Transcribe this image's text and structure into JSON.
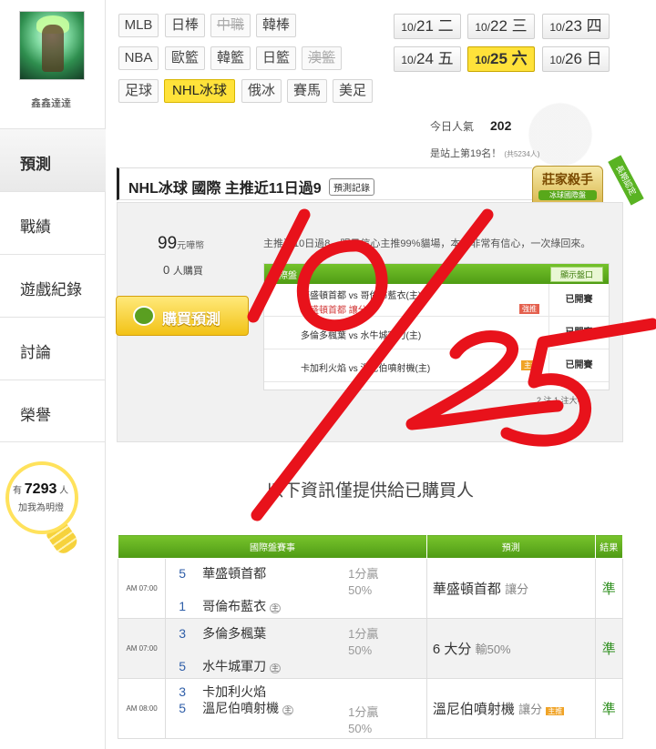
{
  "sidebar": {
    "username": "鑫鑫達達",
    "nav": [
      "預測",
      "戰績",
      "遊戲紀錄",
      "討論",
      "榮譽"
    ],
    "bulb": {
      "prefix": "有",
      "count": "7293",
      "suffix": "人",
      "line2": "加我為明燈"
    }
  },
  "leagues": [
    {
      "label": "MLB",
      "state": "normal"
    },
    {
      "label": "日棒",
      "state": "normal"
    },
    {
      "label": "中職",
      "state": "disabled"
    },
    {
      "label": "韓棒",
      "state": "normal"
    },
    {
      "label": "NBA",
      "state": "normal"
    },
    {
      "label": "歐籃",
      "state": "normal"
    },
    {
      "label": "韓籃",
      "state": "normal"
    },
    {
      "label": "日籃",
      "state": "normal"
    },
    {
      "label": "澳籃",
      "state": "disabled"
    },
    {
      "label": "足球",
      "state": "normal"
    },
    {
      "label": "NHL冰球",
      "state": "selected"
    },
    {
      "label": "俄冰",
      "state": "normal"
    },
    {
      "label": "賽馬",
      "state": "normal"
    },
    {
      "label": "美足",
      "state": "normal"
    }
  ],
  "dates": [
    {
      "md": "10/",
      "d": "21",
      "w": "二"
    },
    {
      "md": "10/",
      "d": "22",
      "w": "三"
    },
    {
      "md": "10/",
      "d": "23",
      "w": "四"
    },
    {
      "md": "10/",
      "d": "24",
      "w": "五"
    },
    {
      "md": "10/",
      "d": "25",
      "w": "六"
    },
    {
      "md": "10/",
      "d": "26",
      "w": "日"
    }
  ],
  "stats": {
    "popularity_label": "今日人氣",
    "popularity_value": "202",
    "rank_text": "是站上第19名！",
    "rank_note": "(共5234人)"
  },
  "badge": {
    "title": "莊家殺手",
    "sub": "冰球國際盤",
    "ribbon": "長期認定"
  },
  "section": {
    "title": "NHL冰球 國際 主推近11日過9",
    "record_button": "預測記錄"
  },
  "purchase": {
    "price": "99",
    "price_unit": "元嘩幣",
    "buyers": "0",
    "buyers_unit": "人購買",
    "buy_button": "購買預測",
    "summary": "主推近10日過8，明日信心主推99%貓場，本場非常有信心，一次綠回來。",
    "mini_header": "國際盤",
    "mini_show_button": "顯示盤口",
    "mini_rows": [
      {
        "line1": "華盛頓首都 vs 哥倫布藍衣(主)",
        "line2": "華盛頓首都 讓分",
        "tag": "強推",
        "status": "已開賽"
      },
      {
        "line1": "多倫多楓葉 vs 水牛城軍刀(主)",
        "line2": "",
        "tag": "",
        "status": "已開賽"
      },
      {
        "line1": "卡加利火焰 vs 溫尼伯噴射機(主)",
        "line2": "",
        "tag": "主推",
        "status": "已開賽"
      }
    ],
    "mini_footer": "2 注   1 注大小"
  },
  "notice": "以下資訊僅提供給已購買人",
  "table": {
    "headers": [
      "國際盤賽事",
      "預測",
      "結果"
    ],
    "rows": [
      {
        "time": "AM 07:00",
        "away_num": "5",
        "away": "華盛頓首都",
        "home_num": "1",
        "home": "哥倫布藍衣",
        "home_mark": "主",
        "odds1": "1分贏",
        "odds2": "50%",
        "pick": "華盛頓首都",
        "pick_note": "讓分",
        "pick_tag": "",
        "result": "準"
      },
      {
        "time": "AM 07:00",
        "away_num": "3",
        "away": "多倫多楓葉",
        "home_num": "5",
        "home": "水牛城軍刀",
        "home_mark": "主",
        "odds1": "1分贏",
        "odds2": "50%",
        "pick": "6 大分",
        "pick_note": "輸50%",
        "pick_tag": "",
        "result": "準"
      },
      {
        "time": "AM 08:00",
        "away_num": "3",
        "away": "卡加利火焰",
        "home_num": "5",
        "home": "溫尼伯噴射機",
        "home_mark": "主",
        "odds1": "1分贏",
        "odds2": "50%",
        "pick": "溫尼伯噴射機",
        "pick_note": "讓分",
        "pick_tag": "主推",
        "result": "準"
      }
    ]
  },
  "handwriting": "10/25",
  "colors": {
    "accent_yellow": "#ffe23a",
    "green": "#5aa81a",
    "ink_red": "#e8121b"
  }
}
